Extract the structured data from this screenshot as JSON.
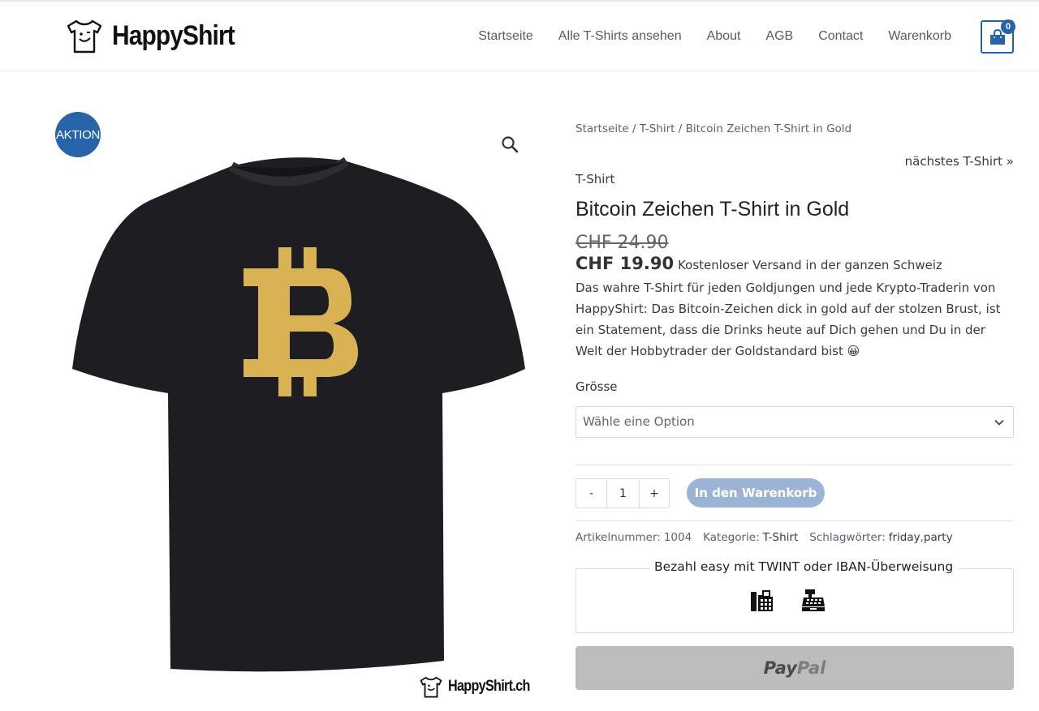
{
  "header": {
    "logo_text": "HappyShirt",
    "nav": [
      "Startseite",
      "Alle T-Shirts ansehen",
      "About",
      "AGB",
      "Contact",
      "Warenkorb"
    ],
    "cart_count": "0"
  },
  "product_image": {
    "badge": "AKTION",
    "watermark": "HappyShirt.ch",
    "shirt_color": "#1e1e22",
    "symbol_color": "#d9b253"
  },
  "breadcrumb": {
    "home": "Startseite",
    "sep1": " / ",
    "category": "T-Shirt",
    "sep2": " / ",
    "current": "Bitcoin Zeichen T-Shirt in Gold"
  },
  "next_link": "nächstes T-Shirt »",
  "product": {
    "category": "T-Shirt",
    "title": "Bitcoin Zeichen T-Shirt in Gold",
    "old_price": "CHF 24.90",
    "new_price": "CHF 19.90",
    "shipping": "Kostenloser Versand in der ganzen Schweiz",
    "description": "Das wahre T-Shirt für jeden Goldjungen und jede Krypto-Traderin von HappyShirt: Das Bitcoin-Zeichen dick in gold auf der stolzen Brust, ist ein Statement, dass die Drinks heute auf Dich gehen und Du in der Welt der Hobbytrader der Goldstandard bist 😀"
  },
  "variation": {
    "label": "Grösse",
    "placeholder": "Wähle eine Option"
  },
  "quantity": {
    "minus": "-",
    "value": "1",
    "plus": "+"
  },
  "add_to_cart": "In den Warenkorb",
  "meta": {
    "sku_label": "Artikelnummer:",
    "sku": "1004",
    "category_label": "Kategorie:",
    "category": "T-Shirt",
    "tags_label": "Schlagwörter:",
    "tag1": "friday",
    "tag_sep": ", ",
    "tag2": "party"
  },
  "payment": {
    "legend": "Bezahl easy mit TWINT oder IBAN-Überweisung",
    "icons": [
      "fax-icon",
      "cash-register-icon"
    ]
  },
  "paypal": {
    "part1": "Pay",
    "part2": "Pal"
  },
  "colors": {
    "accent": "#2763a8",
    "add_to_cart_bg": "#9bb4d6",
    "paypal_bg": "#bcbcbc"
  }
}
